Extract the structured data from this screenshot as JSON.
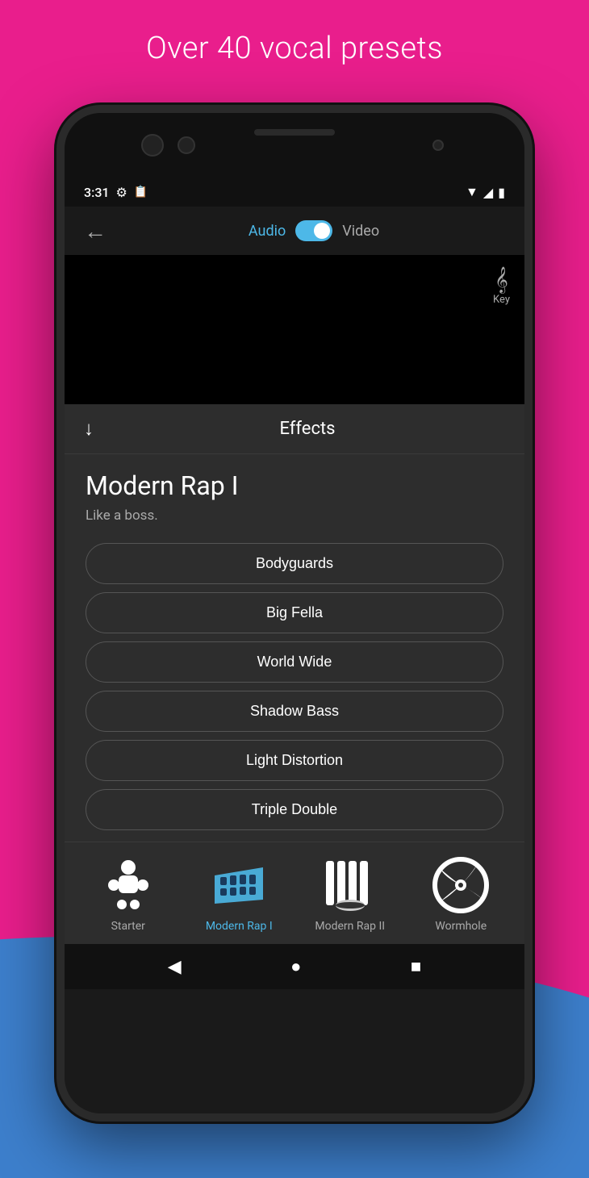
{
  "header": {
    "title": "Over 40 vocal presets"
  },
  "status_bar": {
    "time": "3:31",
    "wifi_icon": "▼",
    "signal_icon": "◢",
    "battery_icon": "▮"
  },
  "nav": {
    "back_icon": "←",
    "audio_label": "Audio",
    "video_label": "Video"
  },
  "key": {
    "label": "Key"
  },
  "effects": {
    "title": "Effects",
    "down_icon": "↓"
  },
  "preset": {
    "name": "Modern Rap I",
    "description": "Like a boss."
  },
  "buttons": [
    {
      "label": "Bodyguards"
    },
    {
      "label": "Big Fella"
    },
    {
      "label": "World Wide"
    },
    {
      "label": "Shadow Bass"
    },
    {
      "label": "Light Distortion"
    },
    {
      "label": "Triple Double"
    }
  ],
  "tabs": [
    {
      "label": "Starter",
      "active": false
    },
    {
      "label": "Modern Rap I",
      "active": true
    },
    {
      "label": "Modern Rap II",
      "active": false
    },
    {
      "label": "Wormhole",
      "active": false
    }
  ],
  "system_nav": {
    "back": "◀",
    "home": "●",
    "recent": "■"
  }
}
